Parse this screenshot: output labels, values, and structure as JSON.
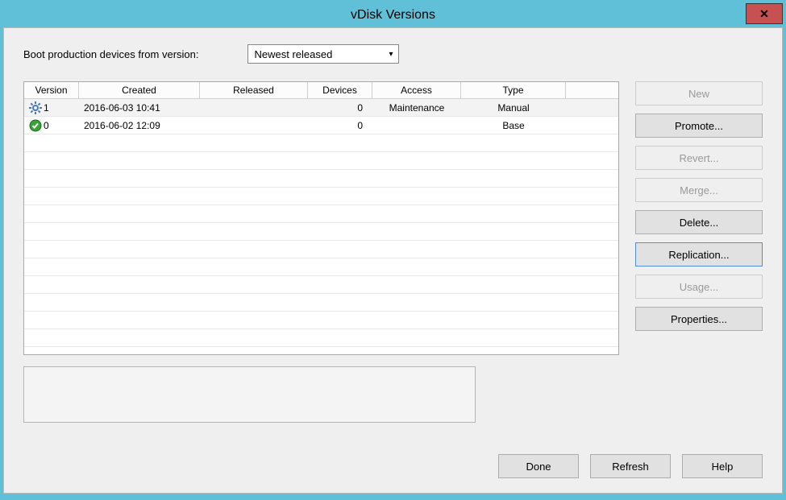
{
  "window": {
    "title": "vDisk Versions"
  },
  "top": {
    "boot_label": "Boot production devices from version:",
    "dropdown_value": "Newest released"
  },
  "grid": {
    "columns": [
      "Version",
      "Created",
      "Released",
      "Devices",
      "Access",
      "Type"
    ],
    "rows": [
      {
        "icon": "gear",
        "version": "1",
        "created": "2016-06-03 10:41",
        "released": "",
        "devices": "0",
        "access": "Maintenance",
        "type": "Manual"
      },
      {
        "icon": "check",
        "version": "0",
        "created": "2016-06-02 12:09",
        "released": "",
        "devices": "0",
        "access": "",
        "type": "Base"
      }
    ]
  },
  "side_buttons": {
    "new": "New",
    "promote": "Promote...",
    "revert": "Revert...",
    "merge": "Merge...",
    "delete": "Delete...",
    "replication": "Replication...",
    "usage": "Usage...",
    "properties": "Properties..."
  },
  "bottom_buttons": {
    "done": "Done",
    "refresh": "Refresh",
    "help": "Help"
  }
}
